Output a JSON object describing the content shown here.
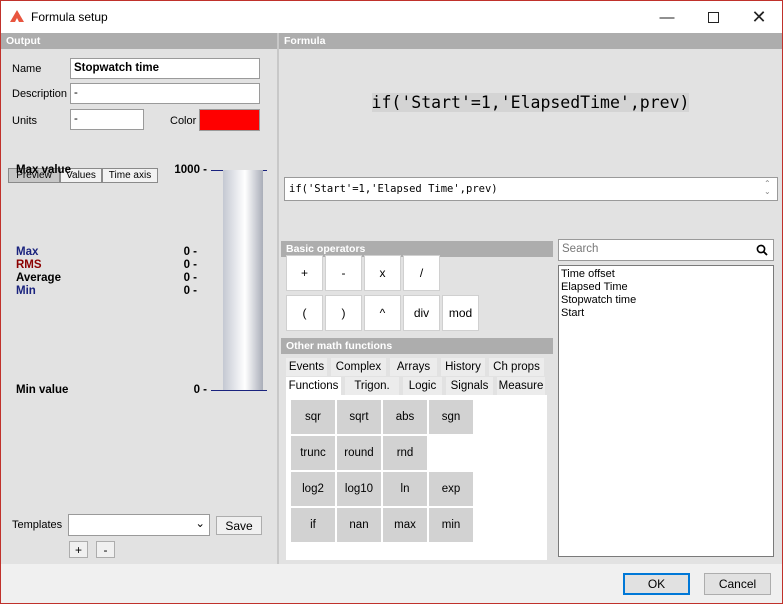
{
  "window": {
    "title": "Formula setup"
  },
  "output": {
    "header": "Output",
    "name_label": "Name",
    "name_value": "Stopwatch time",
    "description_label": "Description",
    "description_value": "-",
    "units_label": "Units",
    "units_value": "-",
    "color_label": "Color",
    "color_value": "#ff0000",
    "tabs": [
      "Preview",
      "Values",
      "Time axis"
    ],
    "preview": {
      "max_value_label": "Max value",
      "max_value": "1000 -",
      "min_value_label": "Min value",
      "min_value": "0 -",
      "stats": [
        {
          "label": "Max",
          "value": "0 -",
          "color": "#1a237e"
        },
        {
          "label": "RMS",
          "value": "0 -",
          "color": "#8b0000"
        },
        {
          "label": "Average",
          "value": "0 -",
          "color": "#000000"
        },
        {
          "label": "Min",
          "value": "0 -",
          "color": "#1a237e"
        }
      ]
    },
    "templates_label": "Templates",
    "templates_value": "",
    "save_label": "Save",
    "add_label": "+",
    "remove_label": "-"
  },
  "formula": {
    "header": "Formula",
    "display_tokens": [
      "if",
      "(",
      "'Start'",
      "=",
      "1",
      ",",
      "'ElapsedTime'",
      ",",
      "prev",
      ")"
    ],
    "input_value": "if('Start'=1,'Elapsed Time',prev)"
  },
  "basic_operators": {
    "header": "Basic operators",
    "buttons": [
      "+",
      "-",
      "x",
      "/",
      "(",
      ")",
      "^",
      "div",
      "mod"
    ]
  },
  "search": {
    "placeholder": "Search"
  },
  "channels": [
    "Time offset",
    "Elapsed Time",
    "Stopwatch time",
    "Start"
  ],
  "math": {
    "header": "Other math functions",
    "tabs_row1": [
      "Events",
      "Complex",
      "Arrays",
      "History",
      "Ch props"
    ],
    "tabs_row2": [
      "Functions",
      "Trigon.",
      "Logic",
      "Signals",
      "Measure"
    ],
    "functions": [
      "sqr",
      "sqrt",
      "abs",
      "sgn",
      "trunc",
      "round",
      "rnd",
      "log2",
      "log10",
      "ln",
      "exp",
      "if",
      "nan",
      "max",
      "min"
    ]
  },
  "dialog": {
    "ok_label": "OK",
    "cancel_label": "Cancel"
  }
}
